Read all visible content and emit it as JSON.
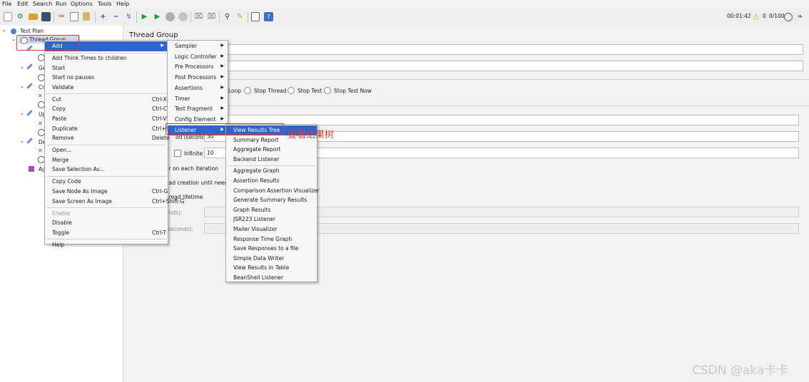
{
  "menubar": {
    "items": [
      "File",
      "Edit",
      "Search",
      "Run",
      "Options",
      "Tools",
      "Help"
    ]
  },
  "toolbar": {
    "icons": [
      "new-icon",
      "templates-icon",
      "open-icon",
      "save-icon",
      "cut-icon",
      "copy-icon",
      "paste-icon",
      "expand-icon",
      "collapse-icon",
      "toggle-icon",
      "start-icon",
      "start-no-pauses-icon",
      "stop-icon",
      "shutdown-icon",
      "clear-icon",
      "clear-all-icon",
      "search-icon",
      "reset-search-icon",
      "function-helper-icon",
      "help-icon"
    ],
    "elapsed": "00:01:42",
    "warnings": "0",
    "threads": "0/100",
    "colors": {
      "start": "#1e9b3a",
      "stop": "#b0b0b0",
      "warning": "#f2c300"
    }
  },
  "tree": {
    "root": "Test Plan",
    "selected": "Thread Group",
    "partial": [
      "Ge",
      "Cr",
      "Up",
      "De",
      "Ag"
    ]
  },
  "panel": {
    "title": "Thread Group",
    "error_actions": [
      "Loop",
      "Stop Thread",
      "Stop Test",
      "Stop Test Now"
    ],
    "ramp_partial": "od (seconds):",
    "ramp_value": "30",
    "infinite_label": "Infinite",
    "loop_value": "10",
    "iteration_text": "er on each iteration",
    "creation_text": "ead creation until need",
    "lifetime_text": "hread lifetime",
    "duration_partial": "onds):",
    "delay_partial": "(seconds):"
  },
  "context_menu": {
    "items": [
      {
        "label": "Add",
        "key": "",
        "submenu": true,
        "selected": true
      },
      {
        "sep": true
      },
      {
        "label": "Add Think Times to children",
        "key": ""
      },
      {
        "label": "Start",
        "key": ""
      },
      {
        "label": "Start no pauses",
        "key": ""
      },
      {
        "label": "Validate",
        "key": ""
      },
      {
        "sep": true
      },
      {
        "label": "Cut",
        "key": "Ctrl-X"
      },
      {
        "label": "Copy",
        "key": "Ctrl-C"
      },
      {
        "label": "Paste",
        "key": "Ctrl-V"
      },
      {
        "label": "Duplicate",
        "key": "Ctrl+Shift-C"
      },
      {
        "label": "Remove",
        "key": "Delete"
      },
      {
        "sep": true
      },
      {
        "label": "Open...",
        "key": ""
      },
      {
        "label": "Merge",
        "key": ""
      },
      {
        "label": "Save Selection As...",
        "key": ""
      },
      {
        "sep": true
      },
      {
        "label": "Copy Code",
        "key": ""
      },
      {
        "label": "Save Node As Image",
        "key": "Ctrl-G"
      },
      {
        "label": "Save Screen As Image",
        "key": "Ctrl+Shift-G"
      },
      {
        "sep": true
      },
      {
        "label": "Enable",
        "key": "",
        "disabled": true
      },
      {
        "label": "Disable",
        "key": ""
      },
      {
        "label": "Toggle",
        "key": "Ctrl-T"
      },
      {
        "sep": true
      },
      {
        "label": "Help",
        "key": ""
      }
    ]
  },
  "add_menu": {
    "items": [
      {
        "label": "Sampler"
      },
      {
        "label": "Logic Controller"
      },
      {
        "label": "Pre Processors"
      },
      {
        "label": "Post Processors"
      },
      {
        "label": "Assertions"
      },
      {
        "label": "Timer"
      },
      {
        "label": "Test Fragment"
      },
      {
        "label": "Config Element"
      },
      {
        "label": "Listener",
        "selected": true
      }
    ]
  },
  "listener_menu": {
    "items": [
      {
        "label": "View Results Tree",
        "selected": true
      },
      {
        "label": "Summary Report"
      },
      {
        "label": "Aggregate Report"
      },
      {
        "label": "Backend Listener"
      },
      {
        "sep": true
      },
      {
        "label": "Aggregate Graph"
      },
      {
        "label": "Assertion Results"
      },
      {
        "label": "Comparison Assertion Visualizer"
      },
      {
        "label": "Generate Summary Results"
      },
      {
        "label": "Graph Results"
      },
      {
        "label": "JSR223 Listener"
      },
      {
        "label": "Mailer Visualizer"
      },
      {
        "label": "Response Time Graph"
      },
      {
        "label": "Save Responses to a file"
      },
      {
        "label": "Simple Data Writer"
      },
      {
        "label": "View Results in Table"
      },
      {
        "label": "BeanShell Listener"
      }
    ]
  },
  "annotation": "查看结果树",
  "watermark": "CSDN @aka卡卡"
}
